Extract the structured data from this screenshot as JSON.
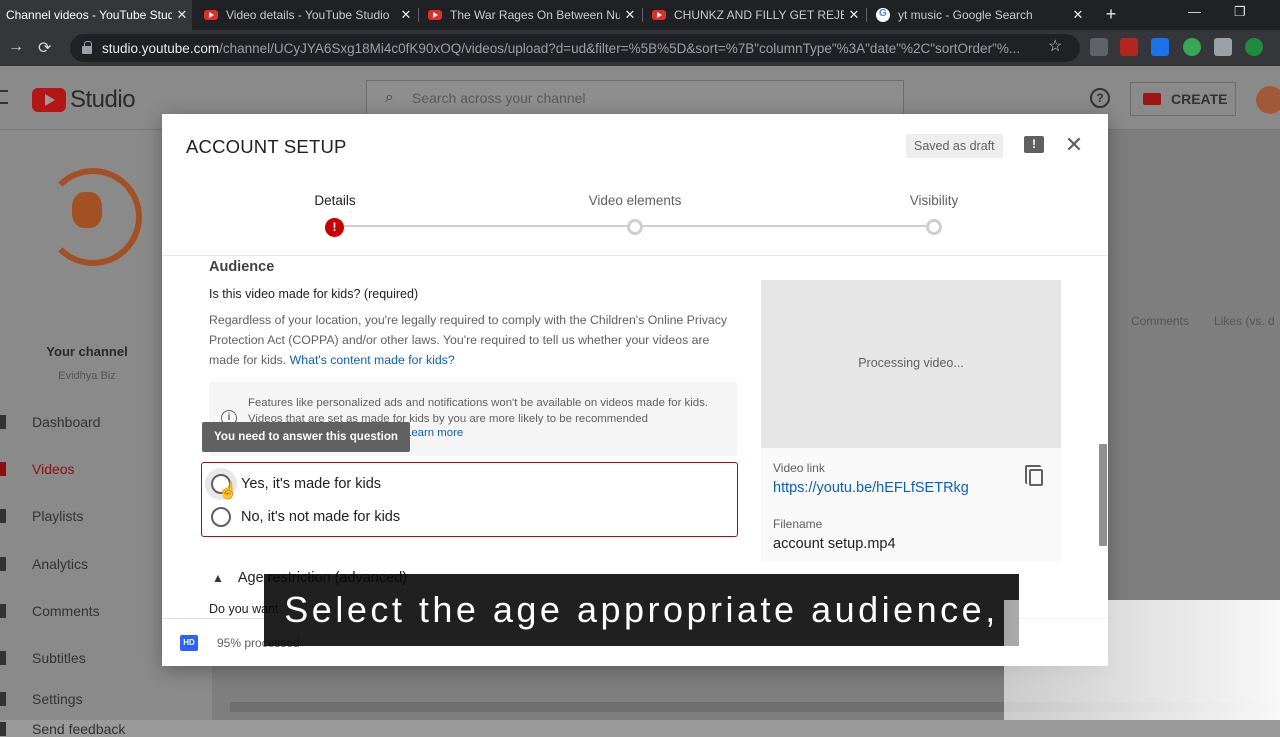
{
  "browser": {
    "tabs": [
      {
        "title": "Channel videos - YouTube Studio",
        "active": true
      },
      {
        "title": "Video details - YouTube Studio",
        "active": false
      },
      {
        "title": "The War Rages On Between Nu",
        "active": false
      },
      {
        "title": "CHUNKZ AND FILLY GET REJEC",
        "active": false
      },
      {
        "title": "yt music - Google Search",
        "active": false
      }
    ],
    "url_host": "studio.youtube.com",
    "url_path": "/channel/UCyJYA6Sxg18Mi4c0fK90xOQ/videos/upload?d=ud&filter=%5B%5D&sort=%7B\"columnType\"%3A\"date\"%2C\"sortOrder\"%..."
  },
  "studio": {
    "logo_text": "Studio",
    "search_placeholder": "Search across your channel",
    "create_label": "CREATE",
    "your_channel": "Your channel",
    "channel_name": "Evidhya Biz",
    "nav": [
      "Dashboard",
      "Videos",
      "Playlists",
      "Analytics",
      "Comments",
      "Subtitles",
      "Settings",
      "Send feedback"
    ],
    "column_headers": [
      "Comments",
      "Likes (vs. d"
    ]
  },
  "dialog": {
    "title": "ACCOUNT SETUP",
    "saved_draft": "Saved as draft",
    "steps": [
      "Details",
      "Video elements",
      "Visibility"
    ],
    "audience": {
      "heading": "Audience",
      "question": "Is this video made for kids? (required)",
      "description": "Regardless of your location, you're legally required to comply with the Children's Online Privacy Protection Act (COPPA) and/or other laws. You're required to tell us whether your videos are made for kids.",
      "description_link": "What's content made for kids?",
      "info_text": "Features like personalized ads and notifications won't be available on videos made for kids. Videos that are set as made for kids by you are more likely to be recommended",
      "info_link": "Learn more",
      "tooltip": "You need to answer this question",
      "option_yes": "Yes, it's made for kids",
      "option_no": "No, it's not made for kids",
      "age_restriction": "Age restriction (advanced)",
      "do_you_want": "Do you want"
    },
    "preview": {
      "processing": "Processing video...",
      "video_link_label": "Video link",
      "video_link": "https://youtu.be/hEFLfSETRkg",
      "filename_label": "Filename",
      "filename": "account setup.mp4"
    },
    "footer": {
      "hd_badge": "HD",
      "progress": "95% processed"
    }
  },
  "caption": "Select the age appropriate audience,"
}
